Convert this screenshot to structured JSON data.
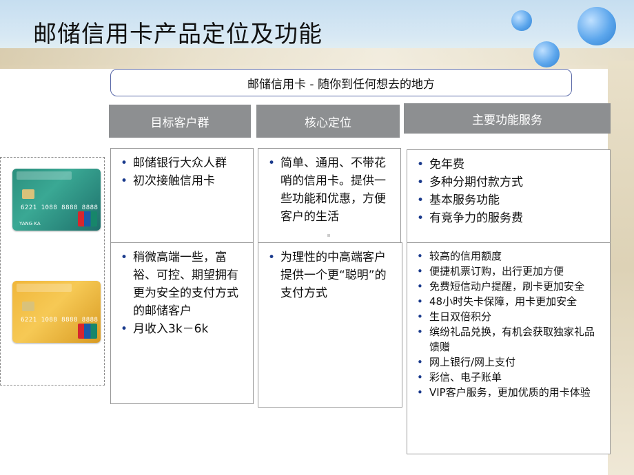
{
  "slide": {
    "title": "邮储信用卡产品定位及功能",
    "slogan": "邮储信用卡 - 随你到任何想去的地方"
  },
  "columns": [
    {
      "header": "目标客户群"
    },
    {
      "header": "核心定位"
    },
    {
      "header": "主要功能服务"
    }
  ],
  "rows": {
    "top": {
      "col1": [
        "邮储银行大众人群",
        "初次接触信用卡"
      ],
      "col2": [
        "简单、通用、不带花哨的信用卡。提供一些功能和优惠，方便客户的生活"
      ],
      "col3": [
        "免年费",
        "多种分期付款方式",
        "基本服务功能",
        "有竞争力的服务费"
      ]
    },
    "bottom": {
      "col1": [
        "稍微高端一些，富裕、可控、期望拥有更为安全的支付方式的邮储客户",
        "月收入3k－6k"
      ],
      "col2": [
        "为理性的中高端客户提供一个更“聪明”的支付方式"
      ],
      "col3": [
        "较高的信用额度",
        "便捷机票订购，出行更加方便",
        "免费短信动户提醒，刷卡更加安全",
        "48小时失卡保障，用卡更加安全",
        "生日双倍积分",
        "缤纷礼品兑换，有机会获取独家礼品馈赠",
        "网上银行/网上支付",
        "彩信、电子账单",
        "VIP客户服务，更加优质的用卡体验"
      ]
    }
  },
  "cards": {
    "green": {
      "number": "6221 1088 8888 8888",
      "holder": "YANG KA"
    },
    "gold": {
      "number": "6221 1088 8888 8888",
      "holder": ""
    }
  },
  "colors": {
    "header_bg": "#8d8f91",
    "bullet": "#1a3a8c",
    "slogan_border": "#5b6aa8"
  }
}
